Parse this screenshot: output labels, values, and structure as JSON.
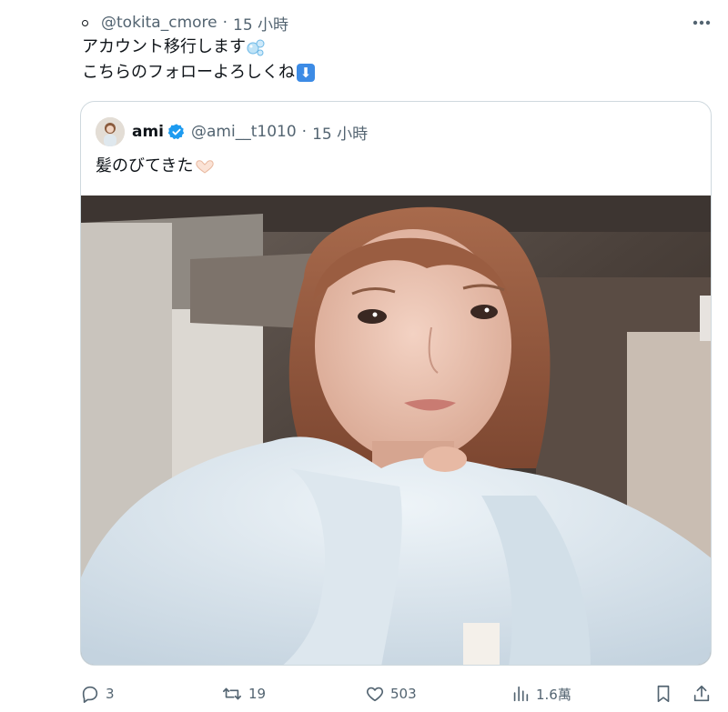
{
  "header": {
    "handle": "@tokita_cmore",
    "separator": "·",
    "time": "15 小時"
  },
  "tweet": {
    "line1": "アカウント移行します",
    "line2": "こちらのフォローよろしくね",
    "arrow_emoji": "⬇"
  },
  "quote": {
    "name": "ami",
    "handle": "@ami__t1010",
    "separator": "·",
    "time": "15 小時",
    "text": "髪のびてきた"
  },
  "actions": {
    "replies": "3",
    "retweets": "19",
    "likes": "503",
    "views": "1.6萬"
  },
  "colors": {
    "text": "#0f1419",
    "muted": "#536471",
    "border": "#cfd9de",
    "verified": "#1d9bf0"
  },
  "icons": [
    "more-icon",
    "verified-badge-icon",
    "reply-icon",
    "retweet-icon",
    "like-icon",
    "views-icon",
    "bookmark-icon",
    "share-icon"
  ]
}
